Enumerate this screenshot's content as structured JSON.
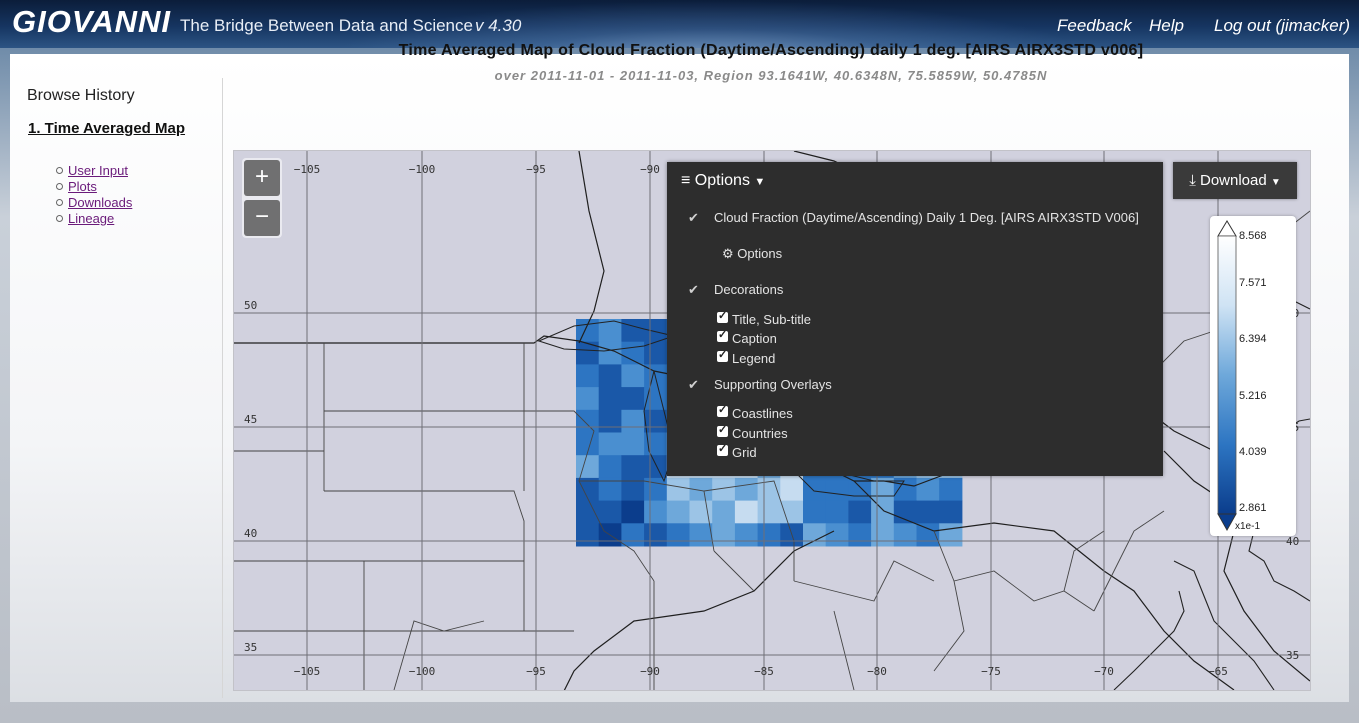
{
  "header": {
    "logo": "GIOVANNI",
    "tagline": "The Bridge Between Data and Science",
    "version": "v 4.30",
    "nav": {
      "feedback": "Feedback",
      "help": "Help",
      "logout": "Log out (jimacker)"
    }
  },
  "sidebar": {
    "title": "Browse History",
    "main_item": "1. Time Averaged Map",
    "sub_items": [
      "User Input",
      "Plots",
      "Downloads",
      "Lineage"
    ]
  },
  "plot": {
    "title": "Time Averaged Map of Cloud Fraction (Daytime/Ascending) daily 1 deg. [AIRS AIRX3STD v006]",
    "subtitle": "over 2011-11-01 - 2011-11-03, Region 93.1641W, 40.6348N, 75.5859W, 50.4785N"
  },
  "map": {
    "zoom_in": "+",
    "zoom_out": "−",
    "lon_labels": [
      "−105",
      "−100",
      "−95",
      "−90",
      "−85",
      "−80",
      "−75",
      "−70",
      "−65"
    ],
    "lat_labels": [
      "50",
      "45",
      "40",
      "35"
    ],
    "colors": {
      "background": "#d1d1de",
      "grid": "#6e6e76",
      "border": "#1f1f1f"
    }
  },
  "options_panel": {
    "header": "Options",
    "layer_name": "Cloud Fraction (Daytime/Ascending) Daily 1 Deg. [AIRS AIRX3STD V006]",
    "layer_options": "Options",
    "decorations_title": "Decorations",
    "decorations": [
      {
        "label": "Title, Sub-title",
        "checked": true
      },
      {
        "label": "Caption",
        "checked": true
      },
      {
        "label": "Legend",
        "checked": true
      }
    ],
    "overlays_title": "Supporting Overlays",
    "overlays": [
      {
        "label": "Coastlines",
        "checked": true
      },
      {
        "label": "Countries",
        "checked": true
      },
      {
        "label": "Grid",
        "checked": true
      }
    ]
  },
  "download_button": "Download",
  "legend": {
    "values": [
      "8.568",
      "7.571",
      "6.394",
      "5.216",
      "4.039",
      "2.861"
    ],
    "unit": "x1e-1",
    "colors": {
      "high": "#ffffff",
      "mid": "#5b9bd5",
      "low": "#0b3d8c"
    }
  }
}
